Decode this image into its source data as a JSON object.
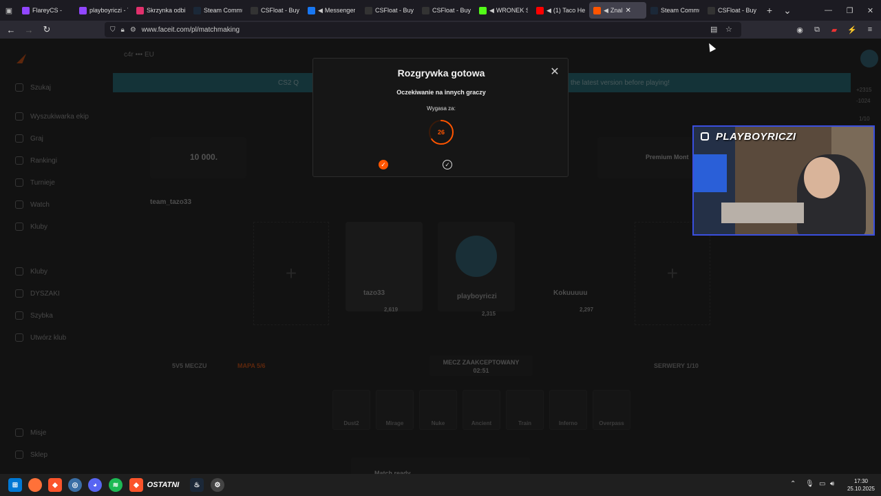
{
  "browser": {
    "tabs": [
      {
        "title": "FlareyCS -",
        "favicon": "twitch-icon",
        "color": "#9146ff",
        "audio": false
      },
      {
        "title": "playboyriczi - T",
        "favicon": "twitch-icon",
        "color": "#9146ff",
        "audio": false
      },
      {
        "title": "Skrzynka odbio",
        "favicon": "instagram-icon",
        "color": "#e1306c",
        "audio": false
      },
      {
        "title": "Steam Commu",
        "favicon": "steam-icon",
        "color": "#1b2838",
        "audio": false
      },
      {
        "title": "CSFloat - Buy &",
        "favicon": "csfloat-icon",
        "color": "#333333",
        "audio": false
      },
      {
        "title": "Messenger",
        "favicon": "facebook-icon",
        "color": "#1877f2",
        "audio": true
      },
      {
        "title": "CSFloat - Buy &",
        "favicon": "csfloat-icon",
        "color": "#333333",
        "audio": false
      },
      {
        "title": "CSFloat - Buy &",
        "favicon": "csfloat-icon",
        "color": "#333333",
        "audio": false
      },
      {
        "title": "WRONEK S",
        "favicon": "kick-icon",
        "color": "#53fc18",
        "audio": true
      },
      {
        "title": "(1) Taco He",
        "favicon": "youtube-icon",
        "color": "#ff0000",
        "audio": true
      },
      {
        "title": "Znal",
        "favicon": "faceit-icon",
        "color": "#ff5500",
        "audio": true,
        "active": true
      },
      {
        "title": "Steam Commu",
        "favicon": "steam-icon",
        "color": "#1b2838",
        "audio": false
      },
      {
        "title": "CSFloat - Buy &",
        "favicon": "csfloat-icon",
        "color": "#333333",
        "audio": false
      }
    ],
    "url": "www.faceit.com/pl/matchmaking"
  },
  "page": {
    "topline": "c4r   •••   EU",
    "banner_left": "CS2 Q",
    "banner_right": "the latest version before playing!",
    "sidebar": [
      {
        "label": "Szukaj"
      },
      {
        "label": "Wyszukiwarka ekip"
      },
      {
        "label": "Graj"
      },
      {
        "label": "Rankingi"
      },
      {
        "label": "Turnieje"
      },
      {
        "label": "Watch"
      },
      {
        "label": "Kluby"
      },
      {
        "label": "Kluby"
      },
      {
        "label": "DYSZAKI"
      },
      {
        "label": "Szybka"
      },
      {
        "label": "Utwórz klub"
      },
      {
        "label": "Misje"
      },
      {
        "label": "Sklep"
      }
    ],
    "elo_label": "10 000.",
    "party_name": "team_tazo33",
    "players": [
      {
        "name": "tazo33",
        "elo": "2,619"
      },
      {
        "name": "playboyriczi",
        "elo": "2,315"
      },
      {
        "name": "Kokuuuuu",
        "elo": "2,297"
      }
    ],
    "match_accepted": "MECZ ZAAKCEPTOWANY",
    "match_timer": "02:51",
    "mode_left": "5V5 MECZU",
    "mode_mid": "MAPA 5/6",
    "servers": "SERWERY 1/10",
    "maps": [
      "Dust2",
      "Mirage",
      "Nuke",
      "Ancient",
      "Train",
      "Inferno",
      "Overpass"
    ],
    "bottom_toast": "Match ready",
    "rail_values": [
      "+2315",
      "-1024",
      "1/10"
    ],
    "premium": "Premium Mont"
  },
  "modal": {
    "title": "Rozgrywka gotowa",
    "subtitle": "Oczekiwanie na innych graczy",
    "expires_label": "Wygasa za:",
    "countdown": "26",
    "countdown_fraction": 0.65,
    "accent": "#ff5500",
    "players_accepted": [
      true,
      false
    ]
  },
  "webcam": {
    "handle": "PLAYBOYRICZI"
  },
  "taskbar": {
    "time": "17:30",
    "date": "25.10.2025",
    "badge": "OSTATNI"
  }
}
